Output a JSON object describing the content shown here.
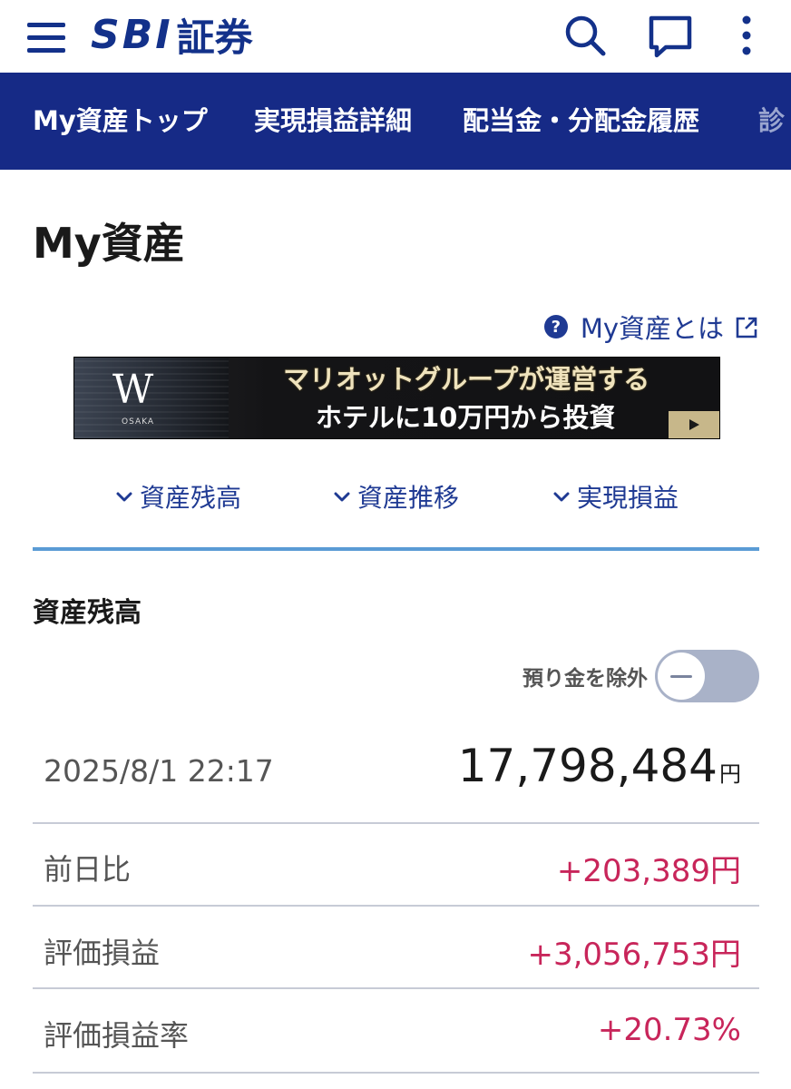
{
  "header": {
    "logo_text": "SBI",
    "logo_suffix": "証券",
    "brand_color": "#13318a"
  },
  "nav": {
    "tabs": [
      {
        "label": "My資産トップ"
      },
      {
        "label": "実現損益詳細"
      },
      {
        "label": "配当金・分配金履歴"
      },
      {
        "label": "診"
      }
    ],
    "background": "#162a86"
  },
  "page": {
    "title": "My資産",
    "about_link": "My資産とは"
  },
  "banner": {
    "logo_letter": "W",
    "logo_sub": "OSAKA",
    "line1": "マリオットグループが運営する",
    "line2": "ホテルに10万円から投資"
  },
  "anchors": [
    {
      "label": "資産残高"
    },
    {
      "label": "資産推移"
    },
    {
      "label": "実現損益"
    }
  ],
  "balance_section": {
    "title": "資産残高",
    "toggle_label": "預り金を除外",
    "toggle_on": false,
    "timestamp": "2025/8/1 22:17",
    "amount": "17,798,484",
    "unit": "円",
    "rows": [
      {
        "label": "前日比",
        "value": "+203,389円"
      },
      {
        "label": "評価損益",
        "value": "+3,056,753円"
      },
      {
        "label": "評価損益率",
        "value": "+20.73%"
      }
    ],
    "positive_color": "#c8255a"
  }
}
